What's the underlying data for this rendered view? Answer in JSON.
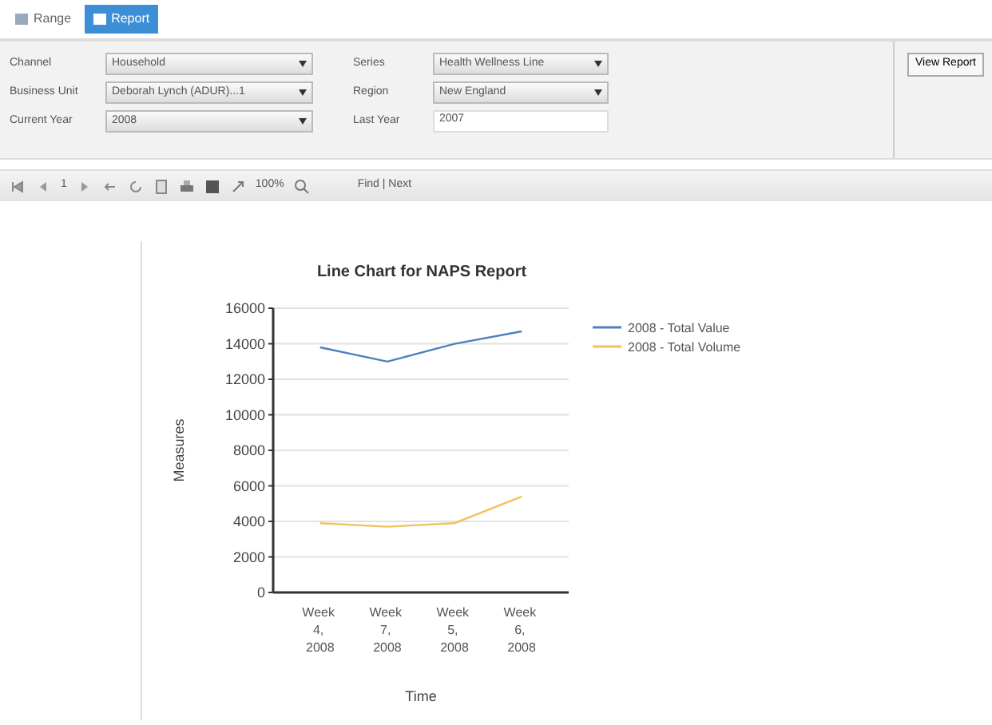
{
  "tabs": [
    {
      "label": "Range",
      "selected": false
    },
    {
      "label": "Report",
      "selected": true
    }
  ],
  "parameters": [
    {
      "label": "Channel",
      "value": "Household"
    },
    {
      "label": "Business Unit",
      "value": "Deborah Lynch (ADUR)...1"
    },
    {
      "label": "Current Year",
      "value": "2008"
    },
    {
      "label": "Series",
      "value": "Health Wellness Line"
    },
    {
      "label": "Region",
      "value": "New England"
    },
    {
      "label": "Last Year",
      "value": "2007",
      "kind": "text"
    }
  ],
  "view_button": "View Report",
  "toolbar": {
    "page": "1",
    "zoom": "100%",
    "find": "Find | Next"
  },
  "chart": {
    "chart_data": {
      "type": "line",
      "title": "Line Chart for NAPS Report",
      "xlabel": "Time",
      "ylabel": "Measures",
      "categories": [
        "Week 4, 2008",
        "Week 7, 2008",
        "Week 5, 2008",
        "Week 6, 2008"
      ],
      "series": [
        {
          "name": "2008 - Total Value",
          "color": "#4f81bd",
          "values": [
            13800,
            13000,
            14000,
            14700
          ]
        },
        {
          "name": "2008 - Total Volume",
          "color": "#f2c25c",
          "values": [
            3900,
            3700,
            3900,
            5400
          ]
        }
      ],
      "grid": true,
      "legend": true,
      "ylim": [
        0,
        16000
      ],
      "yticks": [
        0,
        2000,
        4000,
        6000,
        8000,
        10000,
        12000,
        14000,
        16000
      ]
    }
  }
}
